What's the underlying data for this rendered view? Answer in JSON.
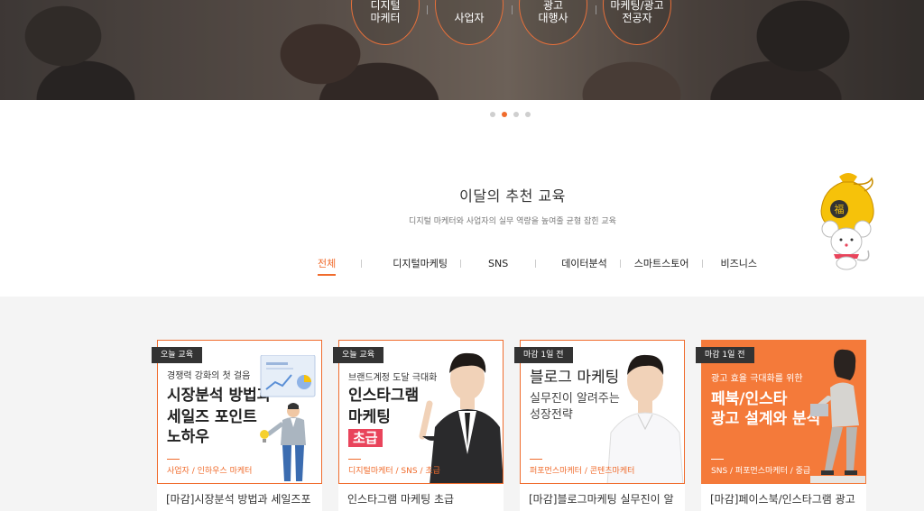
{
  "hero": {
    "circles": [
      {
        "line1": "디지털",
        "line2": "마케터"
      },
      {
        "line1": "사업자",
        "line2": ""
      },
      {
        "line1": "광고",
        "line2": "대행사"
      },
      {
        "line1": "마케팅/광고",
        "line2": "전공자"
      }
    ]
  },
  "carousel": {
    "count": 4,
    "active": 2
  },
  "section": {
    "title": "이달의 추천 교육",
    "subtitle": "디지털 마케터와 사업자의 실무 역량을 높여줄 균형 잡힌 교육"
  },
  "mascot": {
    "glyph": "福"
  },
  "tabs": [
    "전체",
    "디지털마케팅",
    "SNS",
    "데이터분석",
    "스마트스토어",
    "비즈니스"
  ],
  "active_tab": "전체",
  "cards": [
    {
      "badge": "오늘 교육",
      "small": "경쟁력 강화의 첫 걸음",
      "big1": "시장분석 방법과",
      "big2": "세일즈 포인트",
      "big3": "노하우",
      "foot": "사업자 / 인하우스 마케터",
      "title": "[마감]시장분석 방법과 세일즈포"
    },
    {
      "badge": "오늘 교육",
      "small": "브랜드계정 도달 극대화",
      "big1": "인스타그램",
      "big2": "마케팅",
      "pill": "초급",
      "foot": "디지털마케터 / SNS / 초급",
      "title": "인스타그램 마케팅 초급"
    },
    {
      "badge": "마감 1일 전",
      "big1": "블로그 마케팅",
      "mid1": "실무진이 알려주는",
      "mid2": "성장전략",
      "foot": "퍼포먼스마케터 / 콘텐츠마케터",
      "title": "[마감]블로그마케팅 실무진이 알"
    },
    {
      "badge": "마감 1일 전",
      "small": "광고 효율 극대화를 위한",
      "big1": "페북/인스타",
      "big2": "광고 설계와 분석",
      "foot": "SNS / 퍼포먼스마케터 / 중급",
      "title": "[마감]페이스북/인스타그램 광고"
    }
  ],
  "colors": {
    "accent": "#f06c2d",
    "badge_bg": "#333333",
    "pill": "#e9445b"
  }
}
